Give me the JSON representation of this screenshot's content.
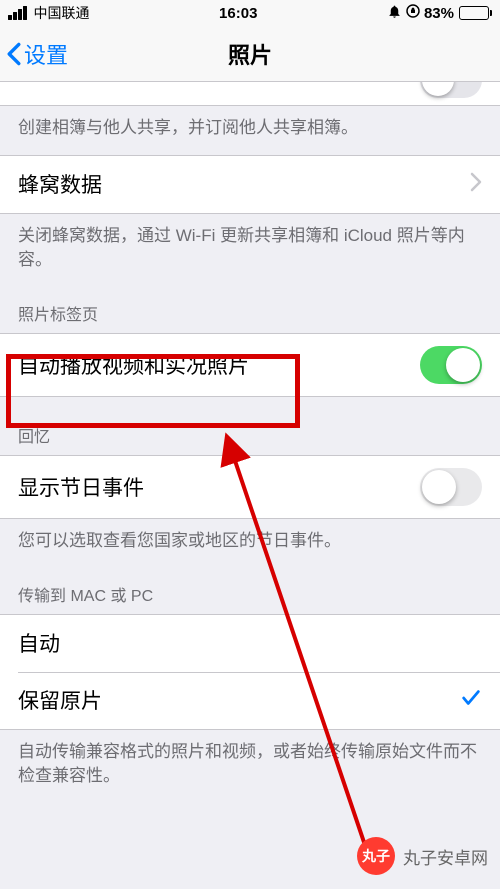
{
  "status": {
    "carrier": "中国联通",
    "time": "16:03",
    "battery_pct": "83%"
  },
  "nav": {
    "back_label": "设置",
    "title": "照片"
  },
  "group_shared": {
    "footer": "创建相簿与他人共享，并订阅他人共享相簿。"
  },
  "group_cellular": {
    "label": "蜂窝数据",
    "footer": "关闭蜂窝数据，通过 Wi-Fi 更新共享相簿和 iCloud 照片等内容。"
  },
  "group_tabs": {
    "header": "照片标签页",
    "autoplay_label": "自动播放视频和实况照片",
    "autoplay_on": true
  },
  "group_memories": {
    "header": "回忆",
    "holiday_label": "显示节日事件",
    "holiday_on": false,
    "footer": "您可以选取查看您国家或地区的节日事件。"
  },
  "group_transfer": {
    "header": "传输到 MAC 或 PC",
    "auto_label": "自动",
    "keep_label": "保留原片",
    "selected": "keep",
    "footer": "自动传输兼容格式的照片和视频，或者始终传输原始文件而不检查兼容性。"
  },
  "watermark": {
    "badge": "丸子",
    "text": "丸子安卓网"
  }
}
